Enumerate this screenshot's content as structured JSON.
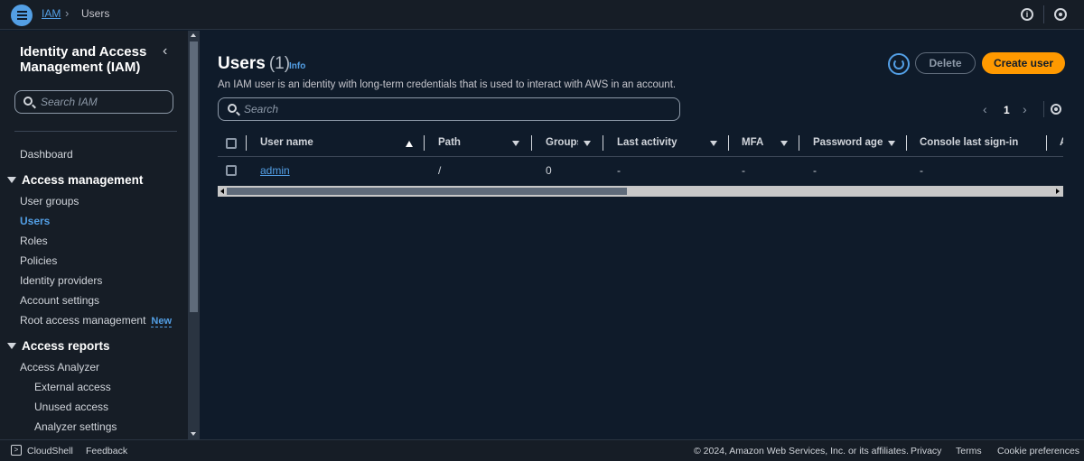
{
  "breadcrumb": {
    "root": "IAM",
    "current": "Users"
  },
  "sidebar": {
    "title": "Identity and Access Management (IAM)",
    "search_placeholder": "Search IAM",
    "items": {
      "dashboard": "Dashboard",
      "access_management": "Access management",
      "user_groups": "User groups",
      "users": "Users",
      "roles": "Roles",
      "policies": "Policies",
      "identity_providers": "Identity providers",
      "account_settings": "Account settings",
      "root_access_management": "Root access management",
      "new_badge": "New",
      "access_reports": "Access reports",
      "access_analyzer": "Access Analyzer",
      "external_access": "External access",
      "unused_access": "Unused access",
      "analyzer_settings": "Analyzer settings"
    }
  },
  "main": {
    "title": "Users",
    "count": "(1)",
    "info": "Info",
    "description": "An IAM user is an identity with long-term credentials that is used to interact with AWS in an account.",
    "delete_label": "Delete",
    "create_label": "Create user",
    "search_placeholder": "Search",
    "page_number": "1"
  },
  "table": {
    "columns": [
      "User name",
      "Path",
      "Groups",
      "Last activity",
      "MFA",
      "Password age",
      "Console last sign-in"
    ],
    "rows": [
      {
        "user_name": "admin",
        "path": "/",
        "groups": "0",
        "last_activity": "-",
        "mfa": "-",
        "password_age": "-",
        "console_last_sign_in": "-"
      }
    ]
  },
  "footer": {
    "cloudshell": "CloudShell",
    "feedback": "Feedback",
    "copyright": "© 2024, Amazon Web Services, Inc. or its affiliates.",
    "privacy": "Privacy",
    "terms": "Terms",
    "cookie_preferences": "Cookie preferences"
  },
  "colors": {
    "accent": "#539fe5",
    "primary_button": "#ff9900",
    "background": "#0f1b2a"
  }
}
